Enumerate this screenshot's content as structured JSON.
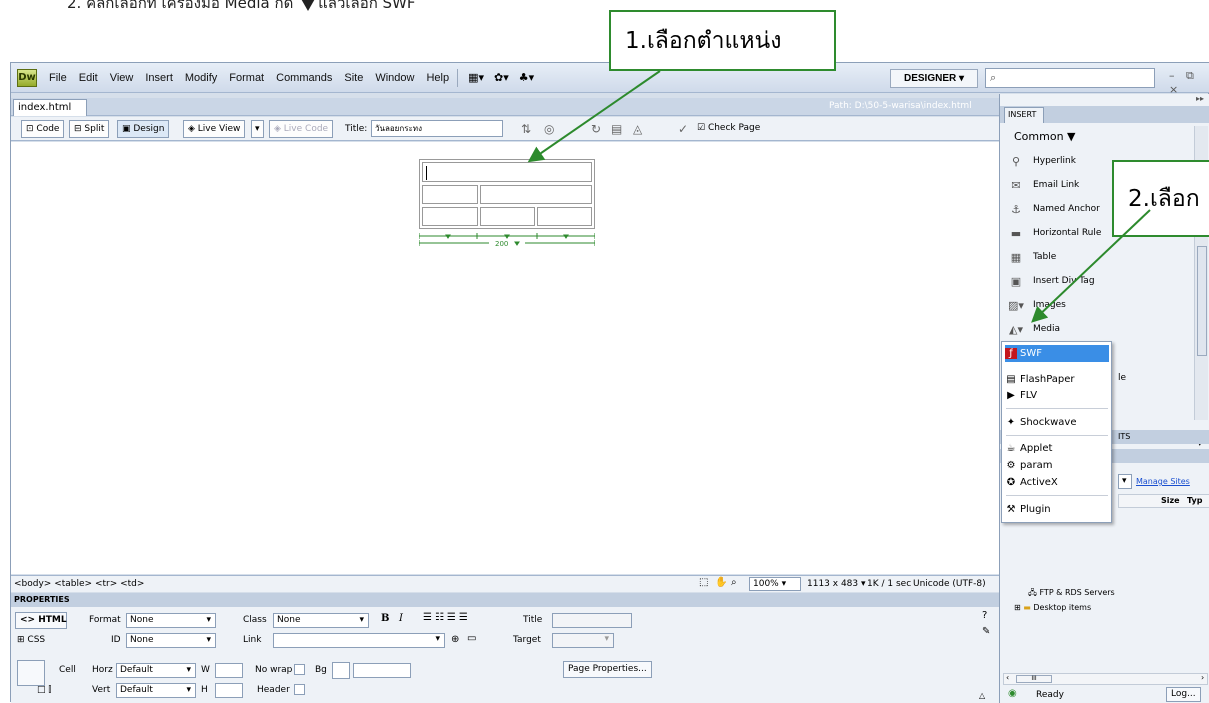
{
  "instruction": {
    "text_before": "2.   คลิกเลือกที่ เครื่องมือ Media กด ",
    "text_after": "แล้วเลือก SWF"
  },
  "callouts": {
    "step1": "1.เลือกตำแหน่ง",
    "step2": "2.เลือก"
  },
  "app": {
    "logo": "Dw",
    "menus": [
      "File",
      "Edit",
      "View",
      "Insert",
      "Modify",
      "Format",
      "Commands",
      "Site",
      "Window",
      "Help"
    ],
    "workspace": "DESIGNER ▾",
    "window_controls": "– ⧉ ×"
  },
  "document": {
    "tab_label": "index.html",
    "path_text": "Path: D:\\50-5-warisa\\index.html"
  },
  "toolbar": {
    "code": "Code",
    "split": "Split",
    "design": "Design",
    "live_view": "Live View",
    "live_code": "Live Code",
    "title_label": "Title:",
    "title_value": "วันลอยกระทง",
    "check_page": "Check Page"
  },
  "canvas": {
    "table_width_label": "200"
  },
  "statusbar": {
    "tag_selector": "<body> <table> <tr> <td>",
    "zoom": "100%",
    "window_size": "1113 x 483",
    "download": "1K / 1 sec",
    "encoding": "Unicode (UTF-8)"
  },
  "properties": {
    "header": "PROPERTIES",
    "html_btn": "HTML",
    "css_btn": "CSS",
    "format_label": "Format",
    "format_value": "None",
    "id_label": "ID",
    "id_value": "None",
    "class_label": "Class",
    "class_value": "None",
    "link_label": "Link",
    "title_label": "Title",
    "target_label": "Target",
    "cell_label": "Cell",
    "horz_label": "Horz",
    "horz_value": "Default",
    "vert_label": "Vert",
    "vert_value": "Default",
    "w_label": "W",
    "h_label": "H",
    "nowrap_label": "No wrap",
    "bg_label": "Bg",
    "header_label": "Header",
    "page_props_btn": "Page Properties..."
  },
  "insert_panel": {
    "tab": "INSERT",
    "category": "Common",
    "items": [
      {
        "label": "Hyperlink",
        "icon": "hyperlink-icon"
      },
      {
        "label": "Email Link",
        "icon": "email-icon"
      },
      {
        "label": "Named Anchor",
        "icon": "anchor-icon"
      },
      {
        "label": "Horizontal Rule",
        "icon": "hr-icon"
      },
      {
        "label": "Table",
        "icon": "table-icon"
      },
      {
        "label": "Insert Div Tag",
        "icon": "div-icon"
      },
      {
        "label": "Images",
        "icon": "image-icon"
      },
      {
        "label": "Media",
        "icon": "media-icon"
      }
    ],
    "partial_label": "le",
    "assets_tab": "ITS",
    "manage_sites": "Manage Sites",
    "col_size": "Size",
    "col_type": "Typ",
    "tree": [
      "FTP & RDS Servers",
      "Desktop items"
    ],
    "scroll_label": "III",
    "ready": "Ready",
    "log_btn": "Log..."
  },
  "media_menu": {
    "items": [
      {
        "label": "SWF",
        "selected": true
      },
      {
        "label": "FlashPaper",
        "selected": false
      },
      {
        "label": "FLV",
        "selected": false
      },
      {
        "label": "Shockwave",
        "selected": false
      },
      {
        "label": "Applet",
        "selected": false
      },
      {
        "label": "param",
        "selected": false
      },
      {
        "label": "ActiveX",
        "selected": false
      },
      {
        "label": "Plugin",
        "selected": false
      }
    ]
  },
  "colors": {
    "callout_border": "#2e8b2e",
    "arrow": "#2d8a2d",
    "menu_selection": "#3a8ee6"
  }
}
